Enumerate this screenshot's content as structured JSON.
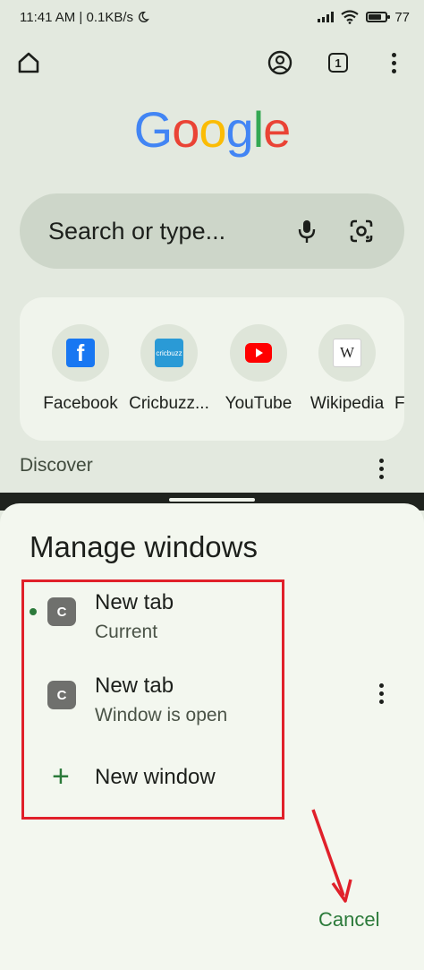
{
  "status_bar": {
    "time_speed": "11:41 AM | 0.1KB/s",
    "dnd_icon": "moon-icon",
    "battery": "77",
    "battery_level": 0.77
  },
  "toolbar": {
    "home_icon": "home-icon",
    "account_icon": "account-icon",
    "tab_count": "1",
    "menu_icon": "more-vert-icon"
  },
  "logo": {
    "letters": [
      "G",
      "o",
      "o",
      "g",
      "l",
      "e"
    ],
    "colors": [
      "#4285F4",
      "#EA4335",
      "#FBBC05",
      "#4285F4",
      "#34A853",
      "#EA4335"
    ]
  },
  "search": {
    "placeholder": "Search or type...",
    "mic_icon": "mic-icon",
    "lens_icon": "lens-icon"
  },
  "shortcuts": [
    {
      "label": "Facebook",
      "icon": "facebook-icon"
    },
    {
      "label": "Cricbuzz...",
      "icon": "cricbuzz-icon"
    },
    {
      "label": "YouTube",
      "icon": "youtube-icon"
    },
    {
      "label": "Wikipedia",
      "icon": "wikipedia-icon"
    },
    {
      "label": "F",
      "icon": ""
    }
  ],
  "shortcut_glyphs": {
    "facebook": "f",
    "cricbuzz": "cricbuzz",
    "wikipedia": "W"
  },
  "discover": {
    "label": "Discover"
  },
  "sheet": {
    "title": "Manage windows",
    "windows": [
      {
        "favicon": "C",
        "title": "New tab",
        "subtitle": "Current"
      },
      {
        "favicon": "C",
        "title": "New tab",
        "subtitle": "Window is open"
      }
    ],
    "new_window_plus": "+",
    "new_window_label": "New window",
    "cancel_label": "Cancel"
  },
  "colors": {
    "accent_green": "#2b7a3a",
    "annotation_red": "#e0202a"
  }
}
